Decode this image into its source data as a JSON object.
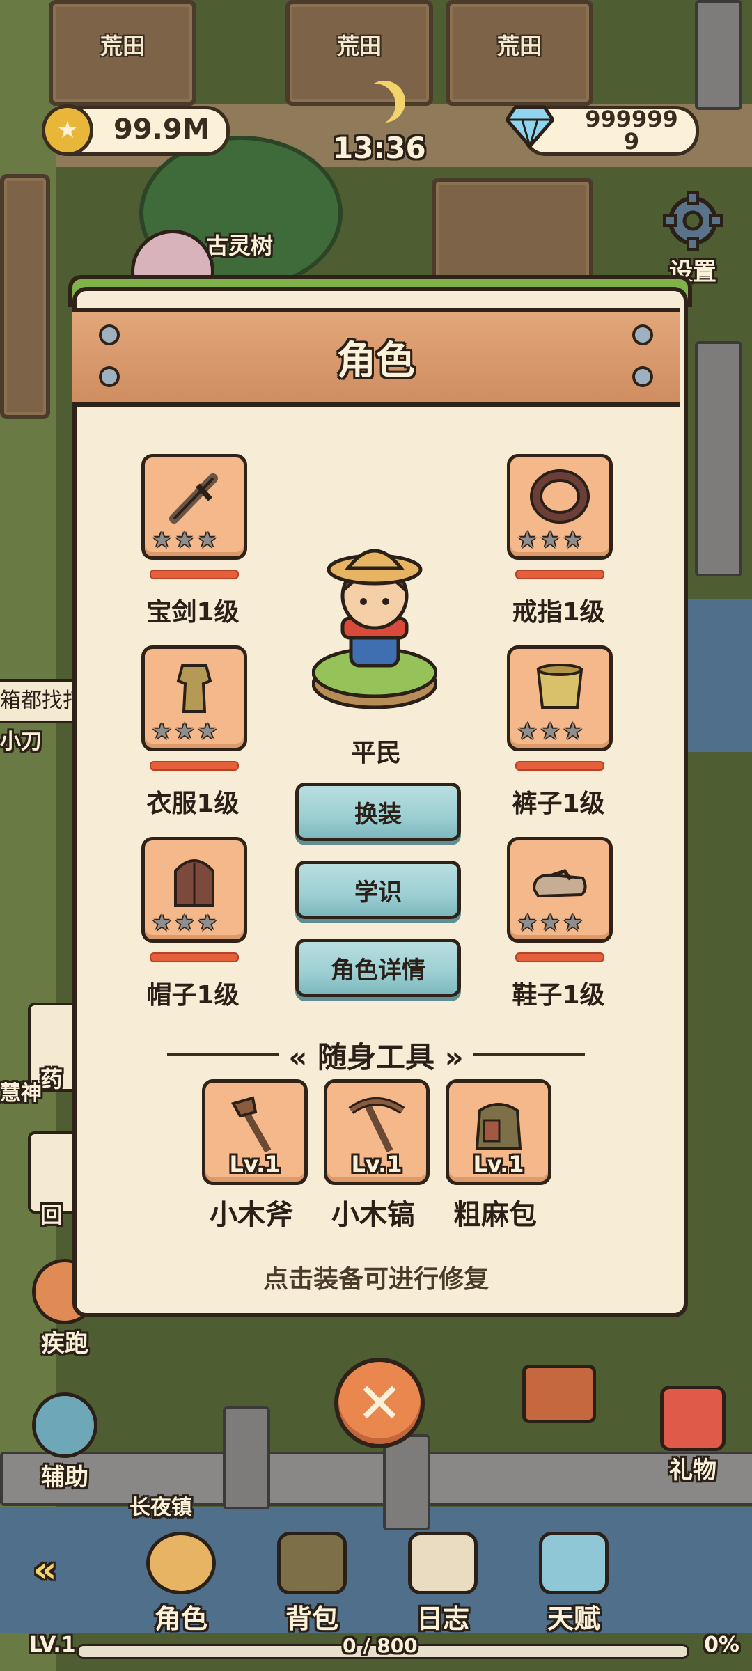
{
  "hud": {
    "coins": "99.9M",
    "time": "13:36",
    "gems_line1": "999999",
    "gems_line2": "9",
    "settings_label": "设置"
  },
  "world": {
    "plot_label": "荒田",
    "tree_label": "古灵树",
    "town_label": "长夜镇",
    "left_partial_1": "箱都找打",
    "left_partial_2": "小刀"
  },
  "side_buttons": {
    "sprint": "疾跑",
    "assist": "辅助",
    "gift": "礼物",
    "medicine": "药",
    "wisdom": "慧神",
    "back": "回"
  },
  "dialog": {
    "title": "角色",
    "character_rank": "平民",
    "equipment_left": [
      {
        "name": "宝剑1级",
        "icon": "sword-icon"
      },
      {
        "name": "衣服1级",
        "icon": "clothes-icon"
      },
      {
        "name": "帽子1级",
        "icon": "hat-icon"
      }
    ],
    "equipment_right": [
      {
        "name": "戒指1级",
        "icon": "ring-icon"
      },
      {
        "name": "裤子1级",
        "icon": "pants-icon"
      },
      {
        "name": "鞋子1级",
        "icon": "shoes-icon"
      }
    ],
    "buttons": {
      "change_outfit": "换装",
      "knowledge": "学识",
      "character_details": "角色详情"
    },
    "tools_title": "随身工具",
    "tools": [
      {
        "name": "小木斧",
        "level": "Lv.1",
        "icon": "wood-axe-icon"
      },
      {
        "name": "小木镐",
        "level": "Lv.1",
        "icon": "wood-pickaxe-icon"
      },
      {
        "name": "粗麻包",
        "level": "Lv.1",
        "icon": "burlap-bag-icon"
      }
    ],
    "hint": "点击装备可进行修复"
  },
  "bottom_nav": {
    "character": "角色",
    "backpack": "背包",
    "journal": "日志",
    "talent": "天赋"
  },
  "progress": {
    "level": "LV.1",
    "xp_text": "0 / 800",
    "percent_text": "0%",
    "fraction": 0
  },
  "colors": {
    "panel_bg": "#f7ecd6",
    "slot_bg": "#f5b88a",
    "button_teal": "#9ccfd3",
    "close_orange": "#e9874f",
    "durability_red": "#e5603a"
  }
}
